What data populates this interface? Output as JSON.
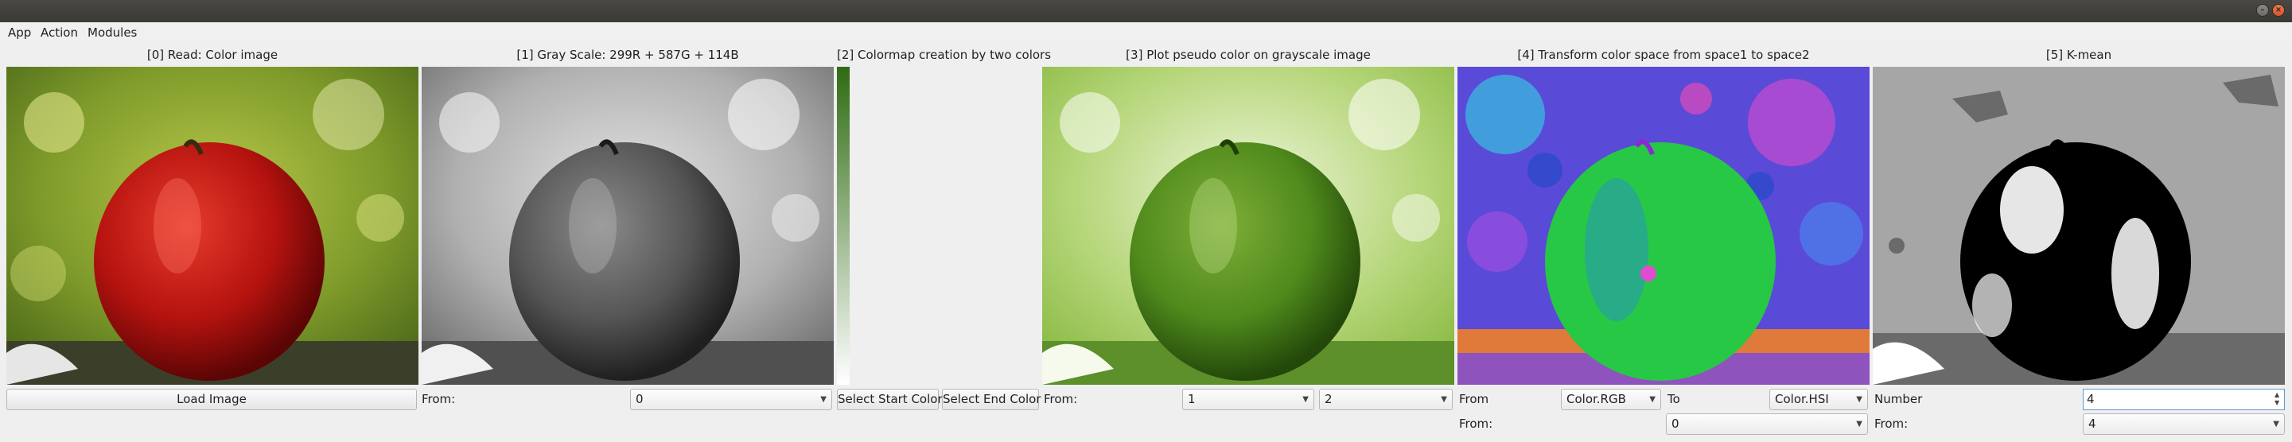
{
  "menu": {
    "app": "App",
    "action": "Action",
    "modules": "Modules"
  },
  "window_controls": {
    "minimize": "–",
    "close": "×"
  },
  "panels": [
    {
      "title": "[0] Read: Color image"
    },
    {
      "title": "[1] Gray Scale: 299R + 587G + 114B"
    },
    {
      "title": "[2] Colormap creation by two colors"
    },
    {
      "title": "[3] Plot pseudo color on grayscale image"
    },
    {
      "title": "[4] Transform color space from space1 to space2"
    },
    {
      "title": "[5] K-mean"
    }
  ],
  "controls": {
    "load_image": "Load Image",
    "gray_from_label": "From:",
    "gray_from_value": "0",
    "select_start_color": "Select Start Color",
    "select_end_color": "Select End Color",
    "pseudo_from_label": "From:",
    "pseudo_from_value": "1",
    "pseudo_colormap_value": "2",
    "cs_from_label": "From",
    "cs_from_value": "Color.RGB",
    "cs_to_label": "To",
    "cs_to_value": "Color.HSI",
    "cs_source_label": "From:",
    "cs_source_value": "0",
    "kmean_number_label": "Number",
    "kmean_number_value": "4",
    "kmean_from_label": "From:",
    "kmean_from_value": "4"
  },
  "colors": {
    "colormap_start": "#ffffff",
    "colormap_end": "#2f6b12"
  }
}
